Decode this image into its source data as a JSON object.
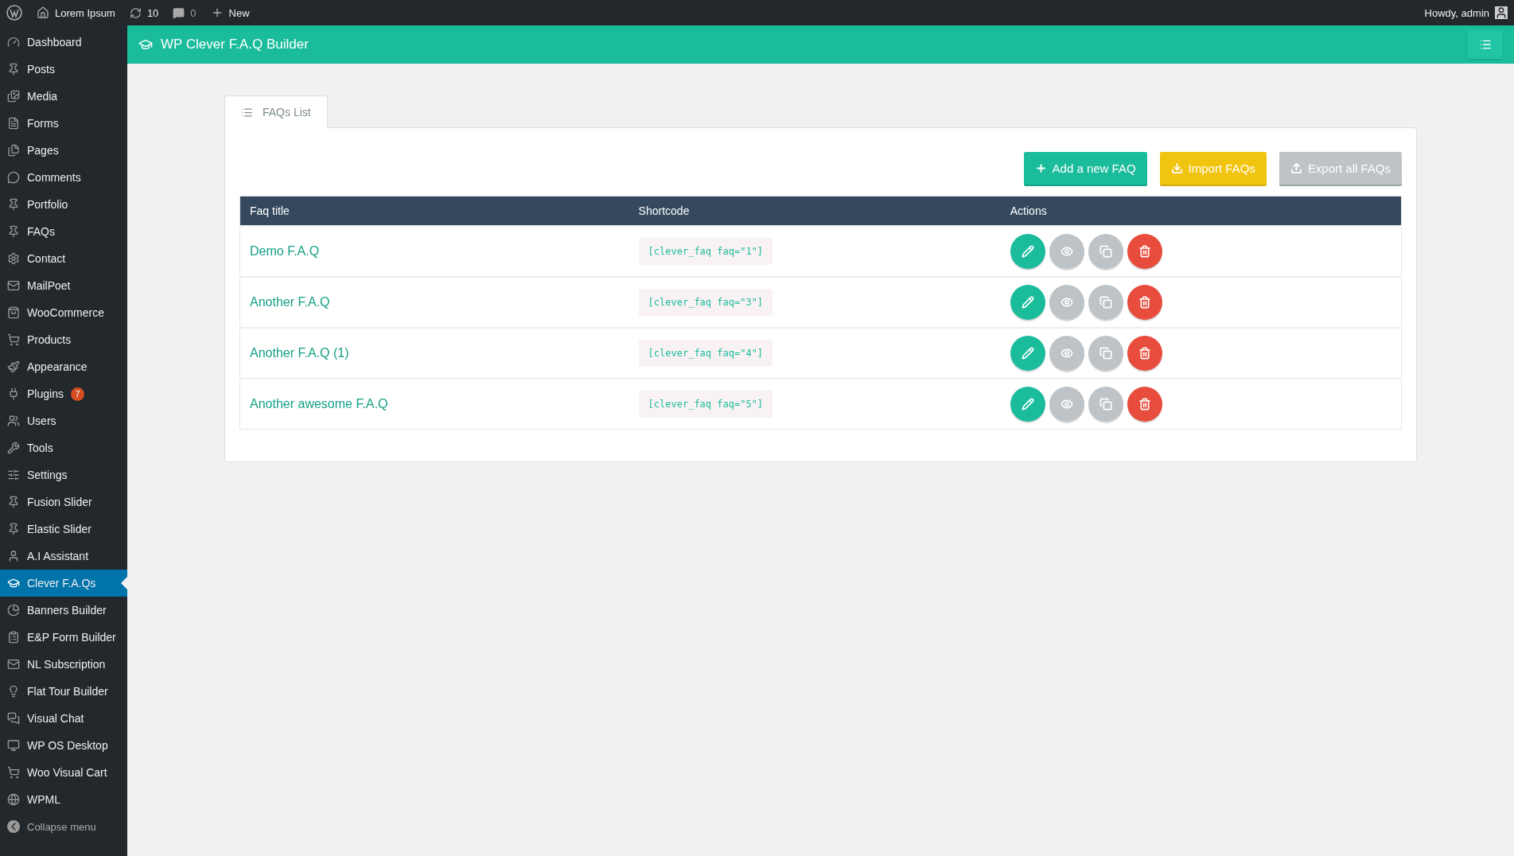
{
  "admin_bar": {
    "site": "Lorem Ipsum",
    "updates": "10",
    "comments": "0",
    "new": "New",
    "greeting": "Howdy, admin"
  },
  "sidebar": {
    "items": [
      {
        "label": "Dashboard",
        "selected": false
      },
      {
        "label": "Posts",
        "selected": false
      },
      {
        "label": "Media",
        "selected": false
      },
      {
        "label": "Forms",
        "selected": false
      },
      {
        "label": "Pages",
        "selected": false
      },
      {
        "label": "Comments",
        "selected": false
      },
      {
        "label": "Portfolio",
        "selected": false
      },
      {
        "label": "FAQs",
        "selected": false
      },
      {
        "label": "Contact",
        "selected": false
      },
      {
        "label": "MailPoet",
        "selected": false
      },
      {
        "label": "WooCommerce",
        "selected": false
      },
      {
        "label": "Products",
        "selected": false
      },
      {
        "label": "Appearance",
        "selected": false
      },
      {
        "label": "Plugins",
        "selected": false,
        "badge": "7"
      },
      {
        "label": "Users",
        "selected": false
      },
      {
        "label": "Tools",
        "selected": false
      },
      {
        "label": "Settings",
        "selected": false
      },
      {
        "label": "Fusion Slider",
        "selected": false
      },
      {
        "label": "Elastic Slider",
        "selected": false
      },
      {
        "label": "A.I Assistant",
        "selected": false
      },
      {
        "label": "Clever F.A.Qs",
        "selected": true
      },
      {
        "label": "Banners Builder",
        "selected": false
      },
      {
        "label": "E&P Form Builder",
        "selected": false
      },
      {
        "label": "NL Subscription",
        "selected": false
      },
      {
        "label": "Flat Tour Builder",
        "selected": false
      },
      {
        "label": "Visual Chat",
        "selected": false
      },
      {
        "label": "WP OS Desktop",
        "selected": false
      },
      {
        "label": "Woo Visual Cart",
        "selected": false
      },
      {
        "label": "WPML",
        "selected": false
      }
    ],
    "collapse": "Collapse menu"
  },
  "header": {
    "title": "WP Clever F.A.Q Builder"
  },
  "tabs": [
    {
      "label": "FAQs List",
      "selected": true
    }
  ],
  "buttons": [
    {
      "label": "Add a new FAQ",
      "kind": "add"
    },
    {
      "label": "Import FAQs",
      "kind": "import"
    },
    {
      "label": "Export all FAQs",
      "kind": "export"
    }
  ],
  "table": {
    "columns": [
      "Faq title",
      "Shortcode",
      "Actions"
    ],
    "rows": [
      {
        "title": "Demo F.A.Q",
        "shortcode": "[clever_faq faq=\"1\"]"
      },
      {
        "title": "Another F.A.Q",
        "shortcode": "[clever_faq faq=\"3\"]"
      },
      {
        "title": "Another F.A.Q (1)",
        "shortcode": "[clever_faq faq=\"4\"]"
      },
      {
        "title": "Another awesome F.A.Q",
        "shortcode": "[clever_faq faq=\"5\"]"
      }
    ]
  }
}
